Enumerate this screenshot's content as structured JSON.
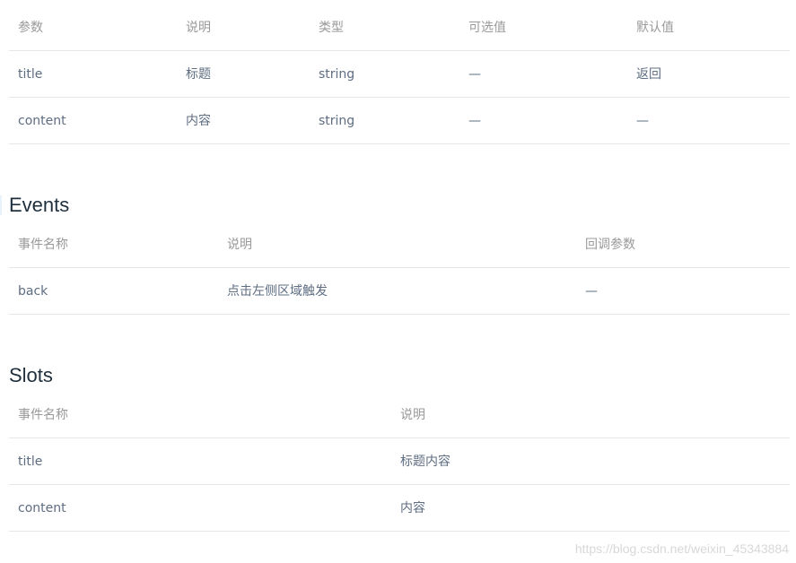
{
  "attributes": {
    "headers": [
      "参数",
      "说明",
      "类型",
      "可选值",
      "默认值"
    ],
    "rows": [
      [
        "title",
        "标题",
        "string",
        "—",
        "返回"
      ],
      [
        "content",
        "内容",
        "string",
        "—",
        "—"
      ]
    ]
  },
  "events": {
    "title": "Events",
    "headers": [
      "事件名称",
      "说明",
      "回调参数"
    ],
    "rows": [
      [
        "back",
        "点击左侧区域触发",
        "—"
      ]
    ]
  },
  "slots": {
    "title": "Slots",
    "headers": [
      "事件名称",
      "说明"
    ],
    "rows": [
      [
        "title",
        "标题内容"
      ],
      [
        "content",
        "内容"
      ]
    ]
  },
  "watermark": "https://blog.csdn.net/weixin_45343884"
}
